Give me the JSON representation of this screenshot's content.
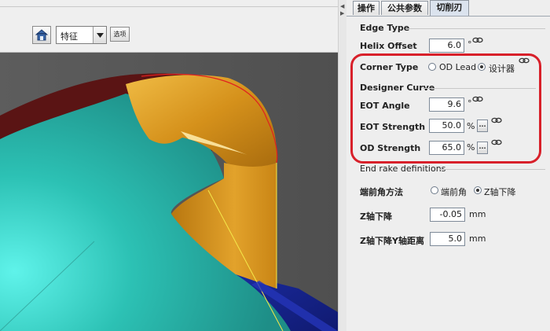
{
  "toolbar": {
    "view_select_value": "特征",
    "options_label": "选项",
    "icons": [
      "home-icon",
      "dropdown-arrow-icon"
    ]
  },
  "tabs": [
    {
      "label": "操作",
      "active": false
    },
    {
      "label": "公共参数",
      "active": false
    },
    {
      "label": "切削刃",
      "active": true
    }
  ],
  "edge_type": {
    "title": "Edge Type",
    "helix_offset_label": "Helix Offset",
    "helix_offset_value": "6.0",
    "helix_offset_unit": "°"
  },
  "corner_type": {
    "label": "Corner Type",
    "options": [
      {
        "label": "OD Lead",
        "selected": false
      },
      {
        "label": "设计器",
        "selected": true
      }
    ]
  },
  "designer_curve": {
    "title": "Designer Curve",
    "eot_angle_label": "EOT Angle",
    "eot_angle_value": "9.6",
    "eot_angle_unit": "°",
    "eot_strength_label": "EOT Strength",
    "eot_strength_value": "50.0",
    "eot_strength_unit": "%",
    "od_strength_label": "OD Strength",
    "od_strength_value": "65.0",
    "od_strength_unit": "%",
    "browse_label": "..."
  },
  "end_rake": {
    "title": "End rake definitions",
    "method_label": "端前角方法",
    "options": [
      {
        "label": "端前角",
        "selected": false
      },
      {
        "label": "Z轴下降",
        "selected": true
      }
    ],
    "z_drop_label": "Z轴下降",
    "z_drop_value": "-0.05",
    "z_drop_unit": "mm",
    "z_drop_y_label": "Z轴下降Y轴距离",
    "z_drop_y_value": "5.0",
    "z_drop_y_unit": "mm"
  },
  "colors": {
    "highlight": "#d8202a",
    "tool_teal": "#2fc4b7",
    "flute_gold": "#d89a1d",
    "tool_back": "#5a1414",
    "blue_part": "#1c2a9a"
  }
}
